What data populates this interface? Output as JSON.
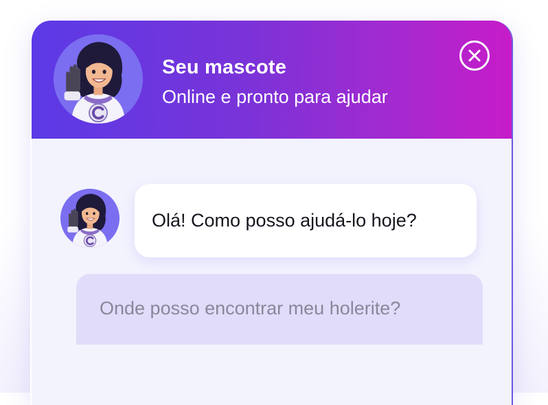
{
  "header": {
    "title": "Seu mascote",
    "status": "Online e pronto para ajudar"
  },
  "messages": [
    {
      "from": "bot",
      "text": "Olá! Como posso ajudá-lo hoje?"
    }
  ],
  "suggestions": [
    {
      "text": "Onde posso encontrar meu holerite?"
    }
  ],
  "icons": {
    "close": "close-icon",
    "avatar": "mascot-avatar"
  },
  "colors": {
    "header_gradient_start": "#5b3ae6",
    "header_gradient_end": "#c61cc8",
    "chat_background": "#f3f3fe",
    "suggestion_background": "#e0dcf9"
  }
}
